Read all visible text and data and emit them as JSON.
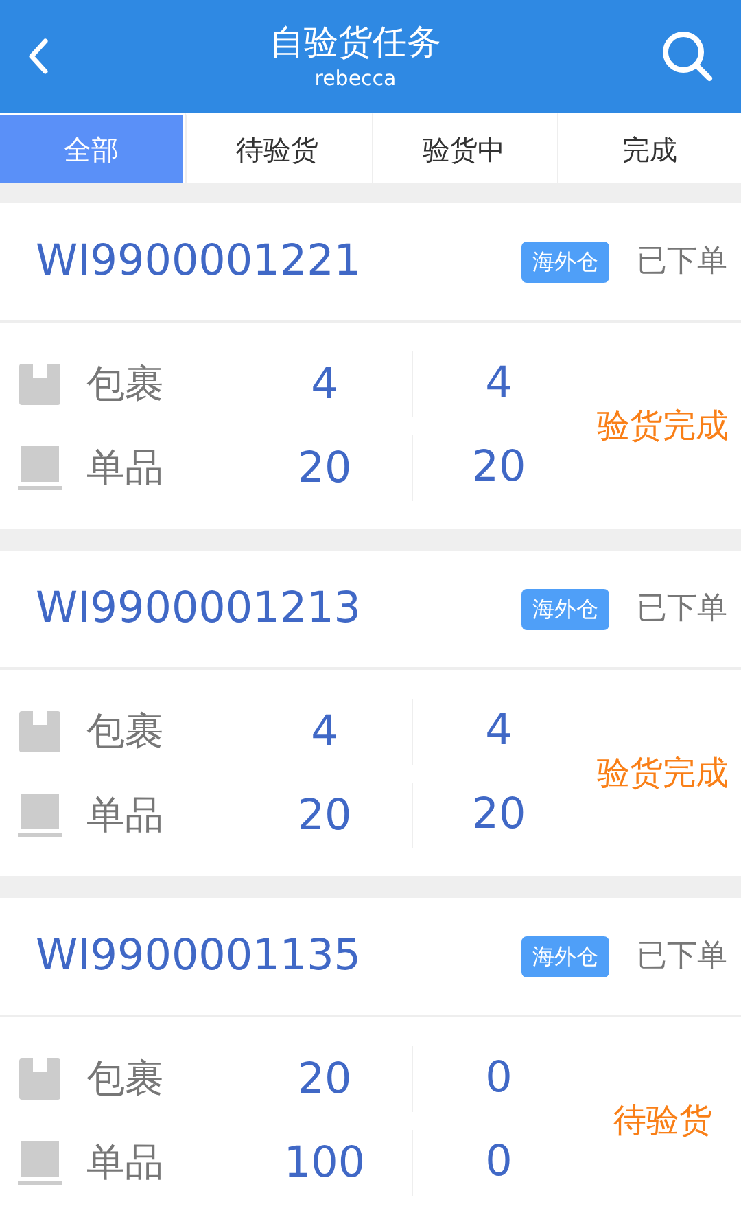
{
  "header": {
    "title": "自验货任务",
    "subtitle": "rebecca"
  },
  "tabs": [
    {
      "label": "全部",
      "selected": true
    },
    {
      "label": "待验货",
      "selected": false
    },
    {
      "label": "验货中",
      "selected": false
    },
    {
      "label": "完成",
      "selected": false
    }
  ],
  "tasks": [
    {
      "number": "WI9900001221",
      "tag": "海外仓",
      "order_status": "已下单",
      "inspection_status": "验货完成",
      "rows": [
        {
          "kind": "package",
          "label": "包裹",
          "column_2": "4",
          "column_3": "4"
        },
        {
          "kind": "item",
          "label": "单品",
          "column_2": "20",
          "column_3": "20"
        }
      ]
    },
    {
      "number": "WI9900001213",
      "tag": "海外仓",
      "order_status": "已下单",
      "inspection_status": "验货完成",
      "rows": [
        {
          "kind": "package",
          "label": "包裹",
          "column_2": "4",
          "column_3": "4"
        },
        {
          "kind": "item",
          "label": "单品",
          "column_2": "20",
          "column_3": "20"
        }
      ]
    },
    {
      "number": "WI9900001135",
      "tag": "海外仓",
      "order_status": "已下单",
      "inspection_status": "待验货",
      "rows": [
        {
          "kind": "package",
          "label": "包裹",
          "column_2": "20",
          "column_3": "0"
        },
        {
          "kind": "item",
          "label": "单品",
          "column_2": "100",
          "column_3": "0"
        }
      ]
    }
  ]
}
